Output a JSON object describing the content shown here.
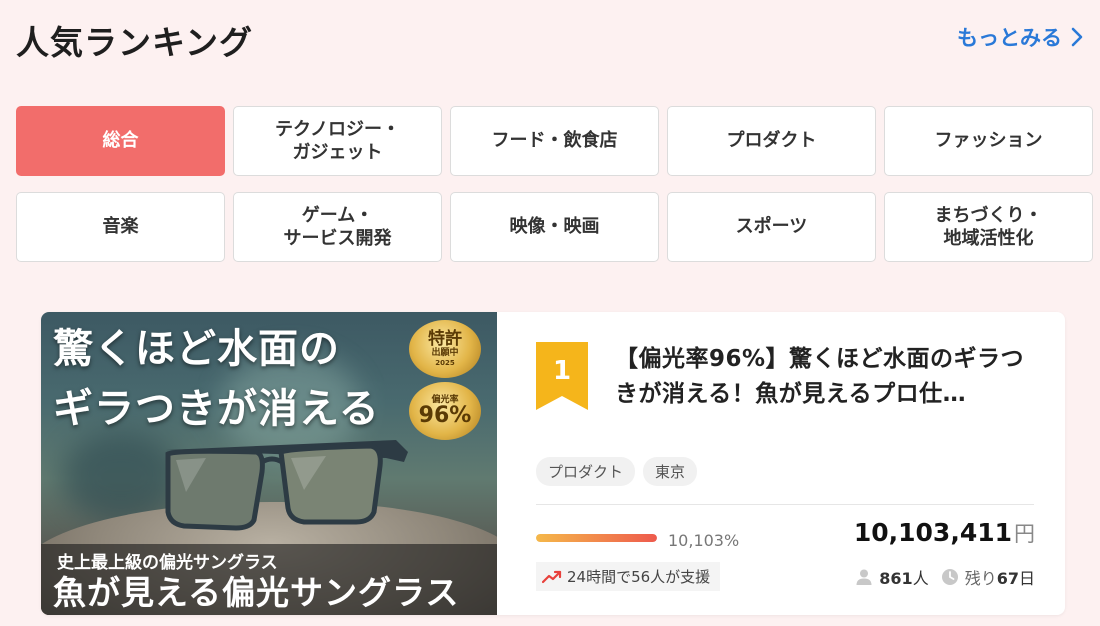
{
  "header": {
    "title": "人気ランキング",
    "more_label": "もっとみる",
    "more_icon": "chevron-right-icon",
    "accent_color": "#2a79d8"
  },
  "categories": [
    {
      "label": "総合",
      "active": true
    },
    {
      "label": "テクノロジー・\nガジェット",
      "active": false
    },
    {
      "label": "フード・飲食店",
      "active": false
    },
    {
      "label": "プロダクト",
      "active": false
    },
    {
      "label": "ファッション",
      "active": false
    },
    {
      "label": "音楽",
      "active": false
    },
    {
      "label": "ゲーム・\nサービス開発",
      "active": false
    },
    {
      "label": "映像・映画",
      "active": false
    },
    {
      "label": "スポーツ",
      "active": false
    },
    {
      "label": "まちづくり・\n地域活性化",
      "active": false
    }
  ],
  "active_color": "#f26d6b",
  "project": {
    "rank": "1",
    "rank_color": "#f5b51b",
    "title": "【偏光率96%】驚くほど水面のギラつきが消える！魚が見えるプロ仕…",
    "image": {
      "headline_1": "驚くほど水面の",
      "headline_2": "ギラつきが消える",
      "badge_1_top": "特許",
      "badge_1_bottom": "出願中",
      "badge_1_small": "2025",
      "badge_2_top": "偏光率",
      "badge_2_bottom": "96%",
      "subline": "史上最上級の偏光サングラス",
      "bottomline": "魚が見える偏光サングラス"
    },
    "tags": [
      "プロダクト",
      "東京"
    ],
    "progress_percent_label": "10,103%",
    "progress_fraction": 1.0,
    "amount": "10,103,411",
    "amount_unit": "円",
    "trend_text": "24時間で56人が支援",
    "trend_icon": "trending-up-icon",
    "supporters": "861",
    "supporters_unit": "人",
    "remaining_label": "残り",
    "remaining_days": "67",
    "remaining_unit": "日"
  }
}
